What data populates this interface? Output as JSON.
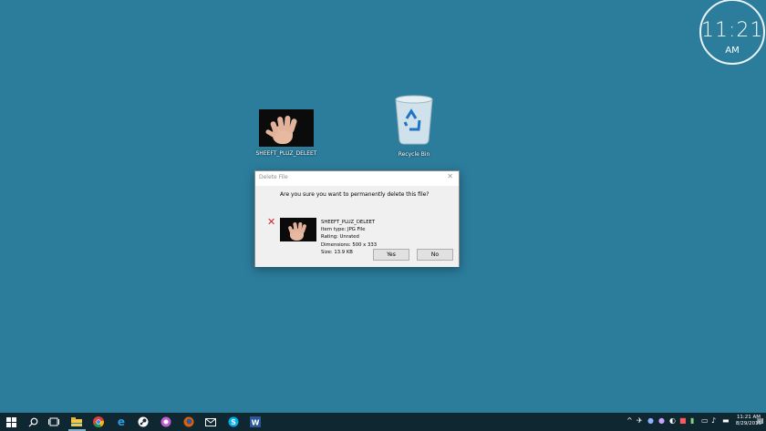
{
  "clock_widget": {
    "time": "11:21",
    "ampm": "AM"
  },
  "desktop": {
    "icons": [
      {
        "label": "SHEEFT_PLUZ_DELEET"
      },
      {
        "label": "Recycle Bin"
      }
    ]
  },
  "dialog": {
    "title": "Delete File",
    "close_glyph": "✕",
    "question": "Are you sure you want to permanently delete this file?",
    "file": {
      "name": "SHEEFT_PLUZ_DELEET",
      "item_type": "Item type: JPG File",
      "rating": "Rating: Unrated",
      "dimensions": "Dimensions: 500 x 333",
      "size": "Size: 13.9 KB"
    },
    "yes_label": "Yes",
    "no_label": "No"
  },
  "taskbar": {
    "time": "11:21 AM",
    "date": "8/29/2015",
    "pinned": [
      "start-icon",
      "search-icon",
      "task-view-icon",
      "file-explorer-icon",
      "chrome-icon",
      "edge-icon",
      "steam-icon",
      "app-icon",
      "firefox-icon",
      "mail-icon",
      "skype-icon",
      "word-icon"
    ],
    "tray_icons": [
      "chevron-up-icon",
      "network-icon",
      "app-icon",
      "app-icon",
      "steam-icon",
      "game-icon",
      "battery-icon",
      "monitor-icon",
      "volume-icon",
      "keyboard-icon",
      "notification-icon"
    ]
  },
  "colors": {
    "desktop": "#2c7c9c",
    "taskbar": "#0f2731",
    "error_x": "#d3242a"
  }
}
